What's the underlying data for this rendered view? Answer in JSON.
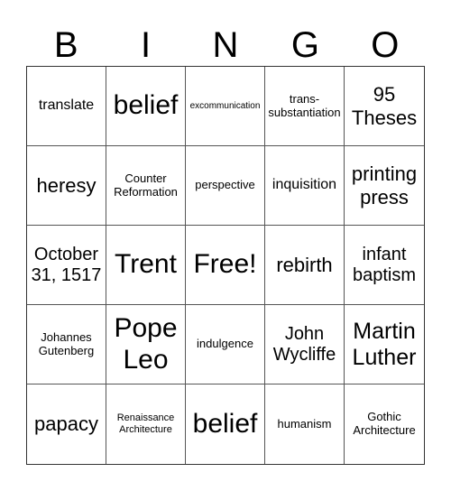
{
  "header": {
    "letters": [
      "B",
      "I",
      "N",
      "G",
      "O"
    ]
  },
  "card": {
    "rows": [
      [
        "translate",
        "belief",
        "excommunication",
        "trans-\nsubstantiation",
        "95 Theses"
      ],
      [
        "heresy",
        "Counter Reformation",
        "perspective",
        "inquisition",
        "printing press"
      ],
      [
        "October 31, 1517",
        "Trent",
        "Free!",
        "rebirth",
        "infant baptism"
      ],
      [
        "Johannes Gutenberg",
        "Pope Leo",
        "indulgence",
        "John Wycliffe",
        "Martin Luther"
      ],
      [
        "papacy",
        "Renaissance Architecture",
        "belief",
        "humanism",
        "Gothic Architecture"
      ]
    ],
    "free_space": "Free!"
  }
}
